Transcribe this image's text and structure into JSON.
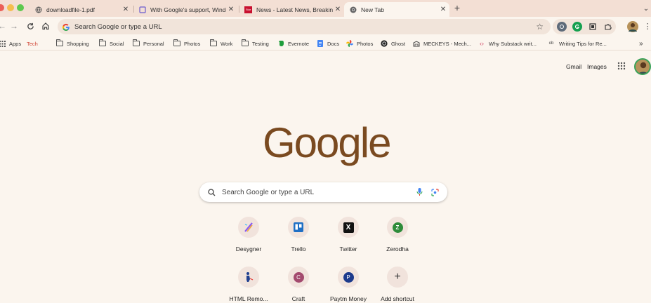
{
  "colors": {
    "tabbar_bg": "#f3dfd4",
    "page_bg": "#fbf5ee",
    "logo": "#7a4a20",
    "tech_bookmark": "#d24a3a"
  },
  "tabs": [
    {
      "title": "downloadfile-1.pdf",
      "icon": "globe-icon",
      "active": false
    },
    {
      "title": "With Google's support, Windo",
      "icon": "page-icon",
      "active": false
    },
    {
      "title": "News - Latest News, Breaking",
      "icon": "news-icon",
      "icon_text": "Star",
      "active": false
    },
    {
      "title": "New Tab",
      "icon": "chrome-icon",
      "active": true
    }
  ],
  "new_tab_symbol": "+",
  "omnibox": {
    "placeholder": "Search Google or type a URL"
  },
  "bookmarks": [
    {
      "label": "Apps",
      "icon": "apps-grid-icon"
    },
    {
      "label": "Tech",
      "icon": "none"
    },
    {
      "label": "Shopping",
      "icon": "folder-icon"
    },
    {
      "label": "Social",
      "icon": "folder-icon"
    },
    {
      "label": "Personal",
      "icon": "folder-icon"
    },
    {
      "label": "Photos",
      "icon": "folder-icon"
    },
    {
      "label": "Work",
      "icon": "folder-icon"
    },
    {
      "label": "Testing",
      "icon": "folder-icon"
    },
    {
      "label": "Evernote",
      "icon": "evernote-icon"
    },
    {
      "label": "Docs",
      "icon": "docs-icon"
    },
    {
      "label": "Photos",
      "icon": "pinwheel-icon"
    },
    {
      "label": "Ghost",
      "icon": "ghost-icon"
    },
    {
      "label": "MECKEYS - Mech...",
      "icon": "keyboard-icon"
    },
    {
      "label": "Why Substack writ...",
      "icon": "code-icon"
    },
    {
      "label": "Writing Tips for Re...",
      "icon": "ob-icon",
      "icon_text": "ob"
    }
  ],
  "bookmarks_overflow": "»",
  "top_links": {
    "gmail": "Gmail",
    "images": "Images"
  },
  "logo_text": "Google",
  "search": {
    "placeholder": "Search Google or type a URL"
  },
  "shortcuts_row1": [
    {
      "label": "Desygner",
      "icon": "desygner-icon"
    },
    {
      "label": "Trello",
      "icon": "trello-icon"
    },
    {
      "label": "Twitter",
      "icon": "x-icon",
      "glyph": "X"
    },
    {
      "label": "Zerodha",
      "icon": "zerodha-icon",
      "glyph": "Z"
    }
  ],
  "shortcuts_row2": [
    {
      "label": "HTML Remo...",
      "icon": "html-remover-icon"
    },
    {
      "label": "Craft",
      "icon": "craft-icon",
      "glyph": "C"
    },
    {
      "label": "Paytm Money",
      "icon": "paytm-icon",
      "glyph": "P"
    },
    {
      "label": "Add shortcut",
      "icon": "plus-icon",
      "glyph": "+"
    }
  ]
}
